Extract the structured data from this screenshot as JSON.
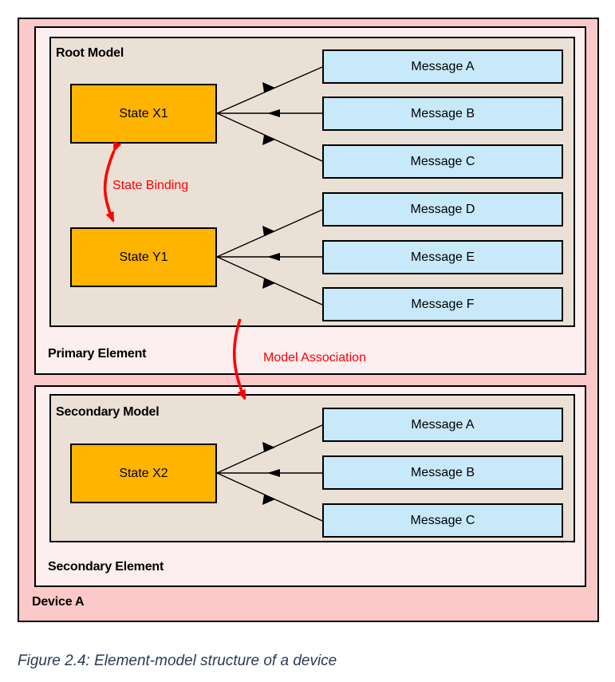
{
  "figure": {
    "caption": "Figure 2.4: Element-model structure of a device",
    "caption_color": "#2b3a55"
  },
  "palette": {
    "device_fill": "#fbc9c9",
    "element_fill": "#fdeef0",
    "model_fill": "#eae0d6",
    "state_fill": "#FFB400",
    "message_fill": "#c7e9f9",
    "annotation_red": "#ff0000",
    "stroke": "#000000"
  },
  "device": {
    "label": "Device A",
    "elements": [
      {
        "label": "Primary Element",
        "model": {
          "label": "Root Model",
          "states": [
            {
              "label": "State X1"
            },
            {
              "label": "State Y1"
            }
          ],
          "messages": [
            {
              "label": "Message A"
            },
            {
              "label": "Message B"
            },
            {
              "label": "Message C"
            },
            {
              "label": "Message D"
            },
            {
              "label": "Message E"
            },
            {
              "label": "Message F"
            }
          ]
        }
      },
      {
        "label": "Secondary Element",
        "model": {
          "label": "Secondary Model",
          "states": [
            {
              "label": "State X2"
            }
          ],
          "messages": [
            {
              "label": "Message A"
            },
            {
              "label": "Message B"
            },
            {
              "label": "Message C"
            }
          ]
        }
      }
    ]
  },
  "annotations": [
    {
      "label": "State Binding",
      "kind": "double-arrow"
    },
    {
      "label": "Model Association",
      "kind": "single-arrow"
    }
  ]
}
